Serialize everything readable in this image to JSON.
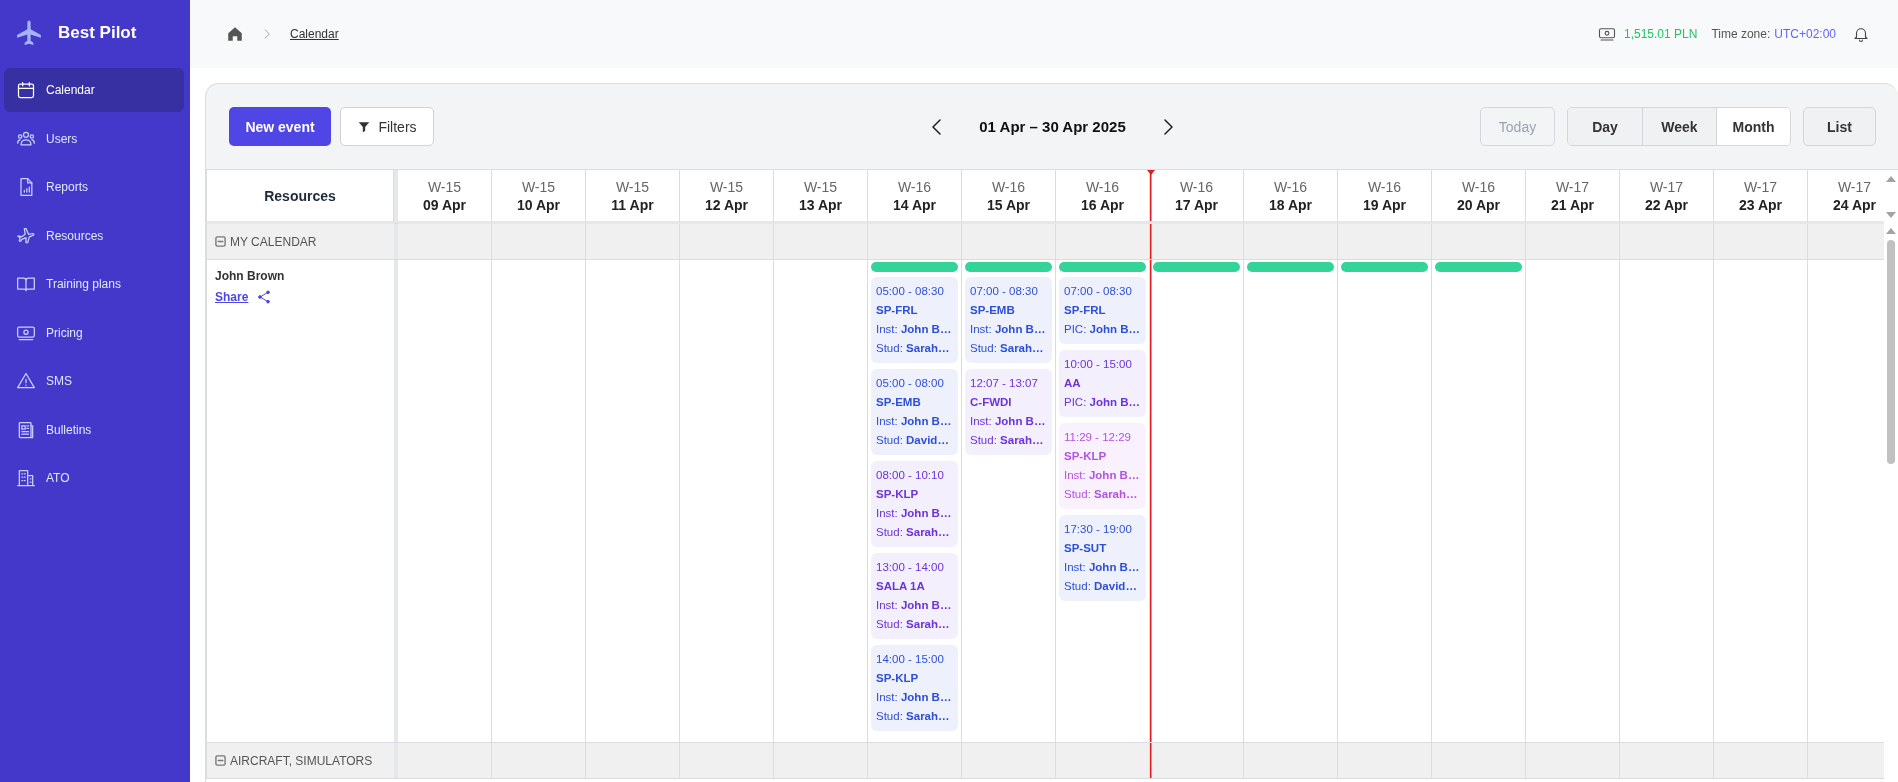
{
  "sidebar": {
    "brand": "Best Pilot",
    "items": [
      {
        "label": "Calendar",
        "selected": true
      },
      {
        "label": "Users",
        "selected": false
      },
      {
        "label": "Reports",
        "selected": false
      },
      {
        "label": "Resources",
        "selected": false
      },
      {
        "label": "Training plans",
        "selected": false
      },
      {
        "label": "Pricing",
        "selected": false
      },
      {
        "label": "SMS",
        "selected": false
      },
      {
        "label": "Bulletins",
        "selected": false
      },
      {
        "label": "ATO",
        "selected": false
      }
    ]
  },
  "topbar": {
    "breadcrumb": "Calendar",
    "balance": "1,515.01 PLN",
    "timezone_label": "Time zone:",
    "timezone": "UTC+02:00"
  },
  "toolbar": {
    "new_event": "New event",
    "filters": "Filters",
    "range": "01 Apr – 30 Apr 2025",
    "today": {
      "label": "Today",
      "disabled": true
    },
    "views": [
      {
        "label": "Day",
        "selected": false
      },
      {
        "label": "Week",
        "selected": false
      },
      {
        "label": "Month",
        "selected": true
      }
    ],
    "list": "List"
  },
  "calendar": {
    "resources_heading": "Resources",
    "days": [
      {
        "week": "W-15",
        "date": "09 Apr",
        "now": false
      },
      {
        "week": "W-15",
        "date": "10 Apr",
        "now": false
      },
      {
        "week": "W-15",
        "date": "11 Apr",
        "now": false
      },
      {
        "week": "W-15",
        "date": "12 Apr",
        "now": false
      },
      {
        "week": "W-15",
        "date": "13 Apr",
        "now": false
      },
      {
        "week": "W-16",
        "date": "14 Apr",
        "now": false
      },
      {
        "week": "W-16",
        "date": "15 Apr",
        "now": false
      },
      {
        "week": "W-16",
        "date": "16 Apr",
        "now": false
      },
      {
        "week": "W-16",
        "date": "17 Apr",
        "now": true
      },
      {
        "week": "W-16",
        "date": "18 Apr",
        "now": false
      },
      {
        "week": "W-16",
        "date": "19 Apr",
        "now": false
      },
      {
        "week": "W-16",
        "date": "20 Apr",
        "now": false
      },
      {
        "week": "W-17",
        "date": "21 Apr",
        "now": false
      },
      {
        "week": "W-17",
        "date": "22 Apr",
        "now": false
      },
      {
        "week": "W-17",
        "date": "23 Apr",
        "now": false
      },
      {
        "week": "W-17",
        "date": "24 Apr",
        "now": false
      }
    ],
    "groups": [
      {
        "label": "MY CALENDAR",
        "expanded": true,
        "resources": [
          {
            "name": "John Brown",
            "share": "Share",
            "days": [
              {
                "available": false
              },
              {
                "available": false
              },
              {
                "available": false
              },
              {
                "available": false
              },
              {
                "available": false
              },
              {
                "available": true,
                "events": [
                  {
                    "time": "05:00 - 08:30",
                    "code": "SP-FRL",
                    "lines": [
                      "Inst: **John B…**",
                      "Stud: **Sarah…**"
                    ],
                    "color": "#2d4fd7"
                  },
                  {
                    "time": "05:00 - 08:00",
                    "code": "SP-EMB",
                    "lines": [
                      "Inst: **John B…**",
                      "Stud: **David…**"
                    ],
                    "color": "#2d4fd7"
                  },
                  {
                    "time": "08:00 - 10:10",
                    "code": "SP-KLP",
                    "lines": [
                      "Inst: **John B…**",
                      "Stud: **Sarah…**"
                    ],
                    "color": "#6b35d9"
                  },
                  {
                    "time": "13:00 - 14:00",
                    "code": "SALA 1A",
                    "lines": [
                      "Inst: **John B…**",
                      "Stud: **Sarah…**"
                    ],
                    "color": "#6b35d9"
                  },
                  {
                    "time": "14:00 - 15:00",
                    "code": "SP-KLP",
                    "lines": [
                      "Inst: **John B…**",
                      "Stud: **Sarah…**"
                    ],
                    "color": "#2d4fd7"
                  }
                ]
              },
              {
                "available": true,
                "events": [
                  {
                    "time": "07:00 - 08:30",
                    "code": "SP-EMB",
                    "lines": [
                      "Inst: **John B…**",
                      "Stud: **Sarah…**"
                    ],
                    "color": "#2d4fd7"
                  },
                  {
                    "time": "12:07 - 13:07",
                    "code": "C-FWDI",
                    "lines": [
                      "Inst: **John B…**",
                      "Stud: **Sarah…**"
                    ],
                    "color": "#6b35d9"
                  }
                ]
              },
              {
                "available": true,
                "events": [
                  {
                    "time": "07:00 - 08:30",
                    "code": "SP-FRL",
                    "lines": [
                      "PIC: **John B…**"
                    ],
                    "color": "#2d4fd7"
                  },
                  {
                    "time": "10:00 - 15:00",
                    "code": "AA",
                    "lines": [
                      "PIC: **John B…**"
                    ],
                    "color": "#6b35d9"
                  },
                  {
                    "time": "11:29 - 12:29",
                    "code": "SP-KLP",
                    "lines": [
                      "Inst: **John B…**",
                      "Stud: **Sarah…**"
                    ],
                    "color": "#b353e3"
                  },
                  {
                    "time": "17:30 - 19:00",
                    "code": "SP-SUT",
                    "lines": [
                      "Inst: **John B…**",
                      "Stud: **David…**"
                    ],
                    "color": "#2d4fd7"
                  }
                ]
              },
              {
                "available": true
              },
              {
                "available": true
              },
              {
                "available": true
              },
              {
                "available": true
              },
              {
                "available": false
              },
              {
                "available": false
              },
              {
                "available": false
              },
              {
                "available": false
              }
            ]
          }
        ]
      },
      {
        "label": "AIRCRAFT, SIMULATORS",
        "expanded": true
      }
    ]
  }
}
